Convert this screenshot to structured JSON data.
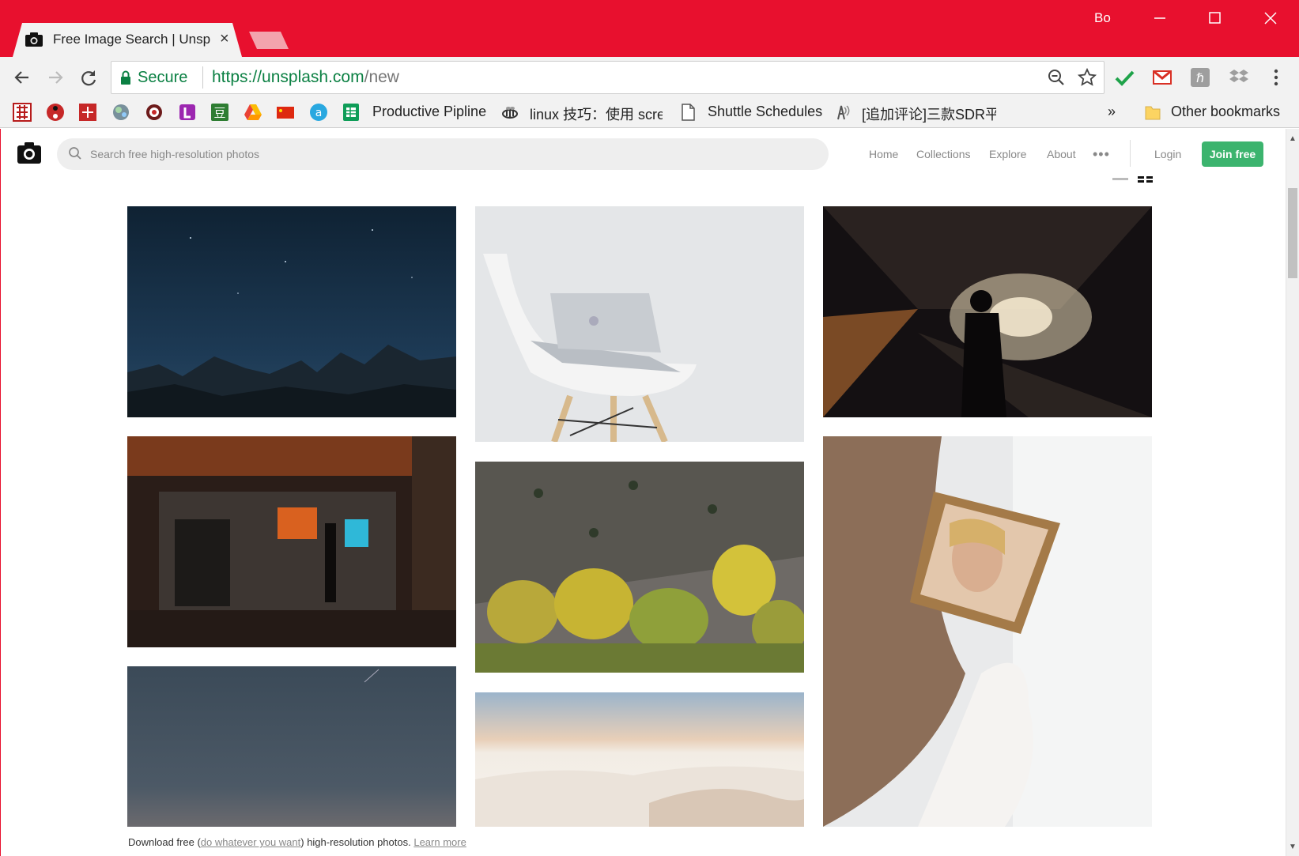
{
  "browser": {
    "tab_title": "Free Image Search | Unsplash",
    "profile_name": "Bo",
    "secure_label": "Secure",
    "url_scheme_host": "https://unsplash.com",
    "url_path": "/new",
    "bookmarks": [
      {
        "label": "Productive Pipline"
      },
      {
        "label": "linux 技巧：使用 screen"
      },
      {
        "label": "Shuttle Schedules"
      },
      {
        "label": "[追加评论]三款SDR平"
      }
    ],
    "other_bookmarks": "Other bookmarks",
    "overflow": "»"
  },
  "site": {
    "search_placeholder": "Search free high-resolution photos",
    "nav": {
      "home": "Home",
      "collections": "Collections",
      "explore": "Explore",
      "about": "About",
      "more": "•••"
    },
    "login": "Login",
    "join": "Join free"
  },
  "footer": {
    "prefix": "Download free (",
    "link1": "do whatever you want",
    "middle": ") high-resolution photos. ",
    "link2": "Learn more"
  },
  "photos": [
    {
      "subject": "night-mountains"
    },
    {
      "subject": "laptop-on-chair"
    },
    {
      "subject": "light-tunnel-silhouette"
    },
    {
      "subject": "storefront-night"
    },
    {
      "subject": "autumn-trees-hillside"
    },
    {
      "subject": "woman-mirror"
    },
    {
      "subject": "dusk-sky"
    },
    {
      "subject": "white-dunes"
    }
  ],
  "colors": {
    "chrome_red": "#e8102e",
    "secure_green": "#0b8043",
    "join_green": "#3cb46e"
  }
}
